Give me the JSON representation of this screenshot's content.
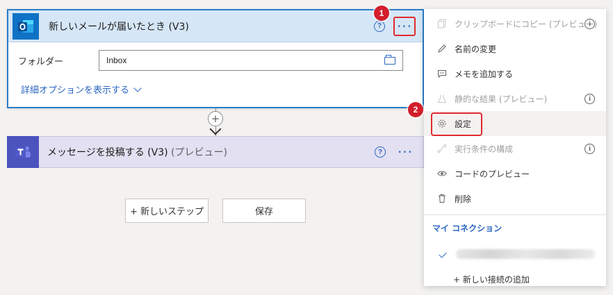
{
  "trigger": {
    "title": "新しいメールが届いたとき (V3)",
    "help": "?",
    "more": "···",
    "folder_label": "フォルダー",
    "folder_value": "Inbox",
    "advanced": "詳細オプションを表示する"
  },
  "connector": {
    "plus": "+"
  },
  "action": {
    "title": "メッセージを投稿する (V3)",
    "title_suffix": "(プレビュー)",
    "help": "?",
    "more": "···"
  },
  "buttons": {
    "new_step": "+ 新しいステップ",
    "save": "保存"
  },
  "menu": {
    "items": [
      {
        "label": "クリップボードにコピー (プレビュー)",
        "icon": "copy-icon"
      },
      {
        "label": "名前の変更",
        "icon": "pencil-icon"
      },
      {
        "label": "メモを追加する",
        "icon": "note-icon"
      },
      {
        "label": "静的な結果 (プレビュー)",
        "icon": "flask-icon"
      },
      {
        "label": "設定",
        "icon": "gear-icon"
      },
      {
        "label": "実行条件の構成",
        "icon": "run-after-icon"
      },
      {
        "label": "コードのプレビュー",
        "icon": "eye-icon"
      },
      {
        "label": "削除",
        "icon": "trash-icon"
      }
    ],
    "info_glyph": "i",
    "connections_header": "マイ コネクション",
    "add_connection": "+ 新しい接続の追加"
  },
  "badges": {
    "one": "1",
    "two": "2"
  },
  "colors": {
    "accent": "#2b66c2",
    "outlook": "#0f72c5",
    "teams": "#4b53bc",
    "highlight": "#e3292f"
  }
}
